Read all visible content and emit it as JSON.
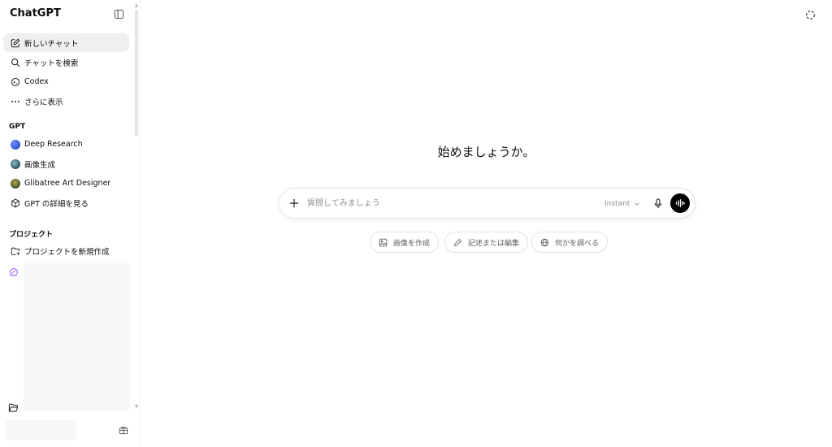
{
  "sidebar": {
    "brand": "ChatGPT",
    "nav": [
      {
        "label": "新しいチャット",
        "icon": "edit-icon"
      },
      {
        "label": "チャットを検索",
        "icon": "search-icon"
      },
      {
        "label": "Codex",
        "icon": "codex-icon"
      },
      {
        "label": "さらに表示",
        "icon": "more-dots-icon"
      }
    ],
    "gpt_section_title": "GPT",
    "gpts": [
      {
        "label": "Deep Research",
        "icon": "deep-research-avatar-icon",
        "color": "#2f57d9"
      },
      {
        "label": "画像生成",
        "icon": "image-gen-avatar-icon",
        "color": "#3b6a7e"
      },
      {
        "label": "Glibatree Art Designer",
        "icon": "art-designer-avatar-icon",
        "color": "#6b5a2e"
      },
      {
        "label": "GPT の詳細を見る",
        "icon": "explore-gpts-icon"
      }
    ],
    "project_section_title": "プロジェクト",
    "projects": [
      {
        "label": "プロジェクトを新規作成",
        "icon": "new-folder-icon"
      }
    ]
  },
  "main": {
    "hero_title": "始めましょうか。",
    "composer": {
      "placeholder": "質問してみましょう",
      "model_label": "Instant"
    },
    "chips": [
      {
        "label": "画像を作成",
        "icon": "image-icon"
      },
      {
        "label": "記述または編集",
        "icon": "pencil-icon"
      },
      {
        "label": "何かを調べる",
        "icon": "globe-icon"
      }
    ]
  },
  "colors": {
    "active_bg": "#efefef",
    "voice_button": "#000000",
    "project_accent": "#9b4dff"
  }
}
